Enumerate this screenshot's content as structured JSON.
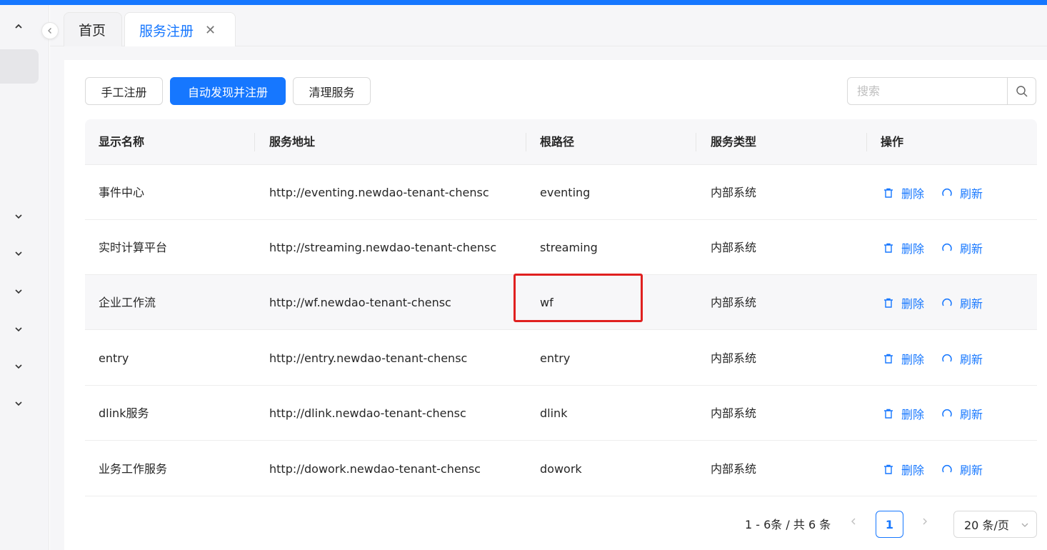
{
  "tabs": [
    {
      "label": "首页",
      "active": false
    },
    {
      "label": "服务注册",
      "active": true,
      "close": "✕"
    }
  ],
  "toolbar": {
    "manual_register": "手工注册",
    "auto_discover": "自动发现并注册",
    "clean_services": "清理服务"
  },
  "search": {
    "placeholder": "搜索",
    "value": ""
  },
  "table": {
    "headers": [
      "显示名称",
      "服务地址",
      "根路径",
      "服务类型",
      "操作"
    ],
    "rows": [
      {
        "name": "事件中心",
        "address": "http://eventing.newdao-tenant-chensc",
        "root": "eventing",
        "type": "内部系统"
      },
      {
        "name": "实时计算平台",
        "address": "http://streaming.newdao-tenant-chensc",
        "root": "streaming",
        "type": "内部系统"
      },
      {
        "name": "企业工作流",
        "address": "http://wf.newdao-tenant-chensc",
        "root": "wf",
        "type": "内部系统"
      },
      {
        "name": "entry",
        "address": "http://entry.newdao-tenant-chensc",
        "root": "entry",
        "type": "内部系统"
      },
      {
        "name": "dlink服务",
        "address": "http://dlink.newdao-tenant-chensc",
        "root": "dlink",
        "type": "内部系统"
      },
      {
        "name": "业务工作服务",
        "address": "http://dowork.newdao-tenant-chensc",
        "root": "dowork",
        "type": "内部系统"
      }
    ],
    "actions": {
      "delete": "删除",
      "refresh": "刷新"
    }
  },
  "pagination": {
    "info": "1 - 6条 / 共 6 条",
    "current_page": "1",
    "page_size": "20 条/页"
  },
  "colors": {
    "accent": "#1677ff",
    "highlight_box": "#e02020"
  }
}
